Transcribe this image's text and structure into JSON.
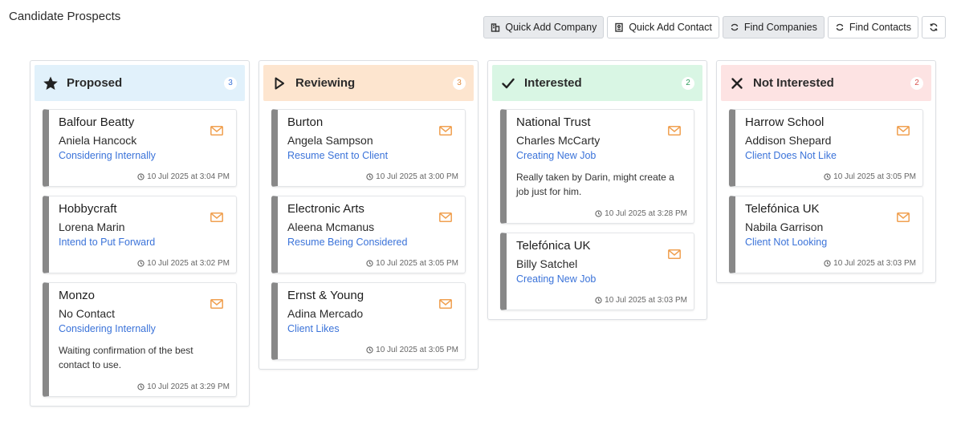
{
  "page": {
    "title": "Candidate Prospects"
  },
  "toolbar": {
    "quick_add_company": "Quick Add Company",
    "quick_add_contact": "Quick Add Contact",
    "find_companies": "Find Companies",
    "find_contacts": "Find Contacts"
  },
  "colors": {
    "proposed_header": "#e1f1fb",
    "reviewing_header": "#fde5cf",
    "interested_header": "#d9f6e4",
    "not_interested_header": "#fde3e3",
    "status_link": "#3b73d9",
    "mail_icon": "#f0a050",
    "card_stripe": "#888888"
  },
  "columns": [
    {
      "title": "Proposed",
      "count": "3",
      "icon": "star-icon",
      "cards": [
        {
          "company": "Balfour Beatty",
          "contact": "Aniela Hancock",
          "status": "Considering Internally",
          "time": "10 Jul 2025 at 3:04 PM"
        },
        {
          "company": "Hobbycraft",
          "contact": "Lorena Marin",
          "status": "Intend to Put Forward",
          "time": "10 Jul 2025 at 3:02 PM"
        },
        {
          "company": "Monzo",
          "contact": "No Contact",
          "status": "Considering Internally",
          "note": "Waiting confirmation of the best contact to use.",
          "time": "10 Jul 2025 at 3:29 PM"
        }
      ]
    },
    {
      "title": "Reviewing",
      "count": "3",
      "icon": "play-icon",
      "cards": [
        {
          "company": "Burton",
          "contact": "Angela Sampson",
          "status": "Resume Sent to Client",
          "time": "10 Jul 2025 at 3:00 PM"
        },
        {
          "company": "Electronic Arts",
          "contact": "Aleena Mcmanus",
          "status": "Resume Being Considered",
          "time": "10 Jul 2025 at 3:05 PM"
        },
        {
          "company": "Ernst & Young",
          "contact": "Adina Mercado",
          "status": "Client Likes",
          "time": "10 Jul 2025 at 3:05 PM"
        }
      ]
    },
    {
      "title": "Interested",
      "count": "2",
      "icon": "check-icon",
      "cards": [
        {
          "company": "National Trust",
          "contact": "Charles McCarty",
          "status": "Creating New Job",
          "note": "Really taken by Darin, might create a job just for him.",
          "time": "10 Jul 2025 at 3:28 PM"
        },
        {
          "company": "Telefónica UK",
          "contact": "Billy Satchel",
          "status": "Creating New Job",
          "time": "10 Jul 2025 at 3:03 PM"
        }
      ]
    },
    {
      "title": "Not Interested",
      "count": "2",
      "icon": "x-icon",
      "cards": [
        {
          "company": "Harrow School",
          "contact": "Addison Shepard",
          "status": "Client Does Not Like",
          "time": "10 Jul 2025 at 3:05 PM"
        },
        {
          "company": "Telefónica UK",
          "contact": "Nabila Garrison",
          "status": "Client Not Looking",
          "time": "10 Jul 2025 at 3:03 PM"
        }
      ]
    }
  ]
}
